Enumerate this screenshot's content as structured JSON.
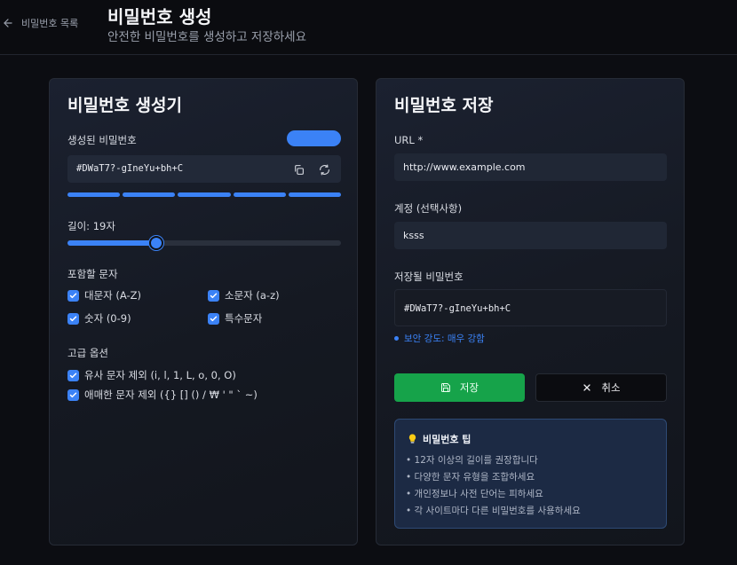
{
  "header": {
    "back_label": "비밀번호 목록",
    "title": "비밀번호 생성",
    "subtitle": "안전한 비밀번호를 생성하고 저장하세요"
  },
  "generator": {
    "title": "비밀번호 생성기",
    "generated_label": "생성된 비밀번호",
    "password": "#DWaT7?-gIneYu+bh+C",
    "strength_segments_filled": 5,
    "strength_segments_total": 5,
    "length_label": "길이: 19자",
    "length_value": 19,
    "length_min": 4,
    "length_max": 50,
    "include_label": "포함할 문자",
    "options": {
      "uppercase": {
        "label": "대문자 (A-Z)",
        "checked": true
      },
      "lowercase": {
        "label": "소문자 (a-z)",
        "checked": true
      },
      "numbers": {
        "label": "숫자 (0-9)",
        "checked": true
      },
      "symbols": {
        "label": "특수문자",
        "checked": true
      }
    },
    "advanced_label": "고급 옵션",
    "advanced": {
      "exclude_similar": {
        "label": "유사 문자 제외 (i, l, 1, L, o, 0, O)",
        "checked": true
      },
      "exclude_ambiguous": {
        "label": "애매한 문자 제외 ({} [] () / ₩ ' \" ` ~)",
        "checked": true
      }
    }
  },
  "save": {
    "title": "비밀번호 저장",
    "url_label": "URL *",
    "url_value": "http://www.example.com",
    "account_label": "계정 (선택사항)",
    "account_value": "ksss",
    "saved_pw_label": "저장될 비밀번호",
    "saved_pw_value": "#DWaT7?-gIneYu+bh+C",
    "strength_text": "보안 강도: 매우 강함",
    "save_button": "저장",
    "cancel_button": "취소"
  },
  "tips": {
    "title": "비밀번호 팁",
    "items": [
      "• 12자 이상의 길이를 권장합니다",
      "• 다양한 문자 유형을 조합하세요",
      "• 개인정보나 사전 단어는 피하세요",
      "• 각 사이트마다 다른 비밀번호를 사용하세요"
    ]
  },
  "colors": {
    "accent": "#3b82f6",
    "save": "#16a34a",
    "background": "#0c0d12"
  }
}
